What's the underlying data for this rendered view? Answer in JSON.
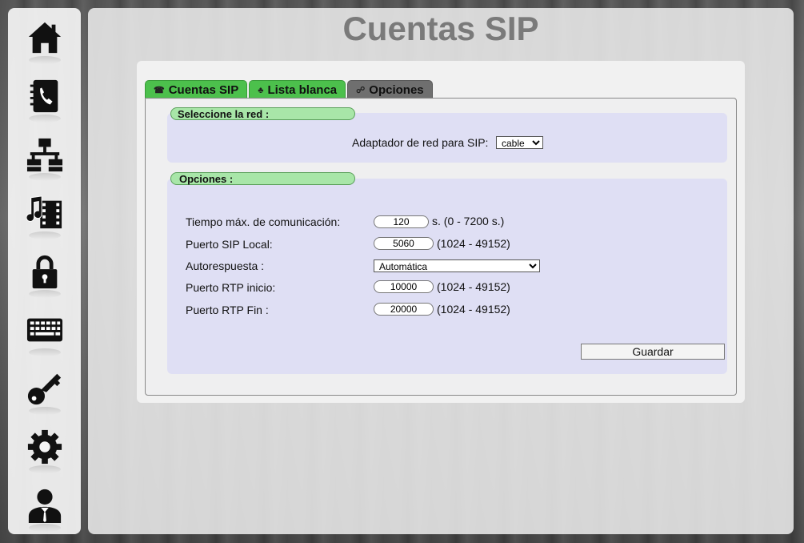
{
  "page_title": "Cuentas SIP",
  "sidebar": {
    "items": [
      {
        "name": "home-icon"
      },
      {
        "name": "phonebook-icon"
      },
      {
        "name": "network-icon"
      },
      {
        "name": "media-icon"
      },
      {
        "name": "lock-icon"
      },
      {
        "name": "keyboard-icon"
      },
      {
        "name": "key-icon"
      },
      {
        "name": "gear-icon"
      },
      {
        "name": "user-icon"
      }
    ]
  },
  "tabs": [
    {
      "label": "Cuentas SIP",
      "icon": "phone-icon",
      "active": false
    },
    {
      "label": "Lista blanca",
      "icon": "contacts-icon",
      "active": false
    },
    {
      "label": "Opciones",
      "icon": "link-icon",
      "active": true
    }
  ],
  "network_section": {
    "title": "Seleccione la red :",
    "adapter_label": "Adaptador de red para SIP:",
    "adapter_value": "cable"
  },
  "options_section": {
    "title": "Opciones :",
    "fields": [
      {
        "label": "Tiempo máx. de comunicación:",
        "value": "120",
        "hint": "s. (0 - 7200 s.)"
      },
      {
        "label": "Puerto SIP Local:",
        "value": "5060",
        "hint": "(1024 - 49152)"
      },
      {
        "label": "Autorespuesta :",
        "value": "Automática",
        "hint": ""
      },
      {
        "label": "Puerto RTP inicio:",
        "value": "10000",
        "hint": "(1024 - 49152)"
      },
      {
        "label": "Puerto RTP Fin :",
        "value": "20000",
        "hint": "(1024 - 49152)"
      }
    ],
    "save_label": "Guardar"
  },
  "colors": {
    "tab_green": "#4cc04c",
    "tab_active": "#6f6f6f",
    "section_pill": "#a8e6a8",
    "section_bg": "#dcdcf5"
  }
}
